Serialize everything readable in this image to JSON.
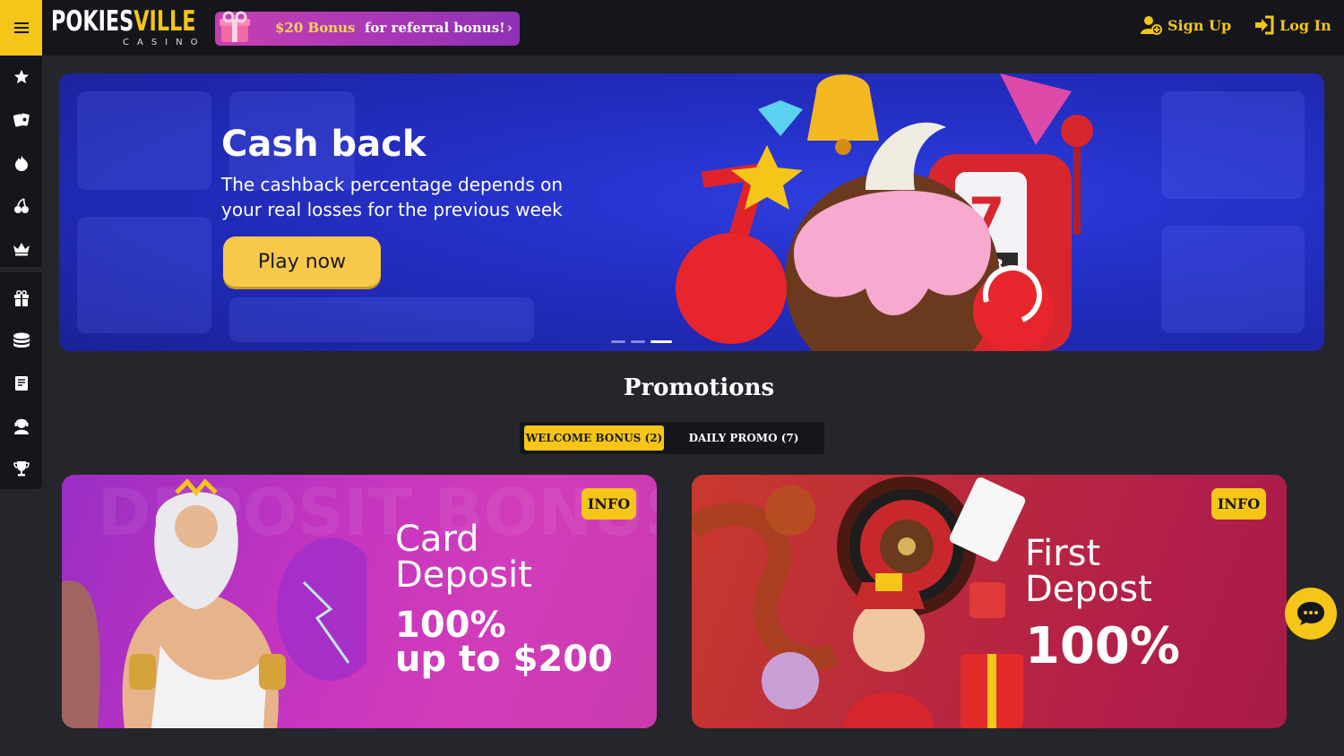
{
  "header": {
    "logo_main_a": "POKIES",
    "logo_main_b": "VILLE",
    "logo_sub": "CASINO",
    "referral_amount": "$20 Bonus",
    "referral_text": "for referral bonus!",
    "signup_label": "Sign Up",
    "login_label": "Log In"
  },
  "sidebar": {
    "icons": [
      "star-icon",
      "cards-icon",
      "fire-icon",
      "cherries-icon",
      "crown-icon",
      "gift-icon",
      "coins-icon",
      "receipt-icon",
      "support-agent-icon",
      "trophy-icon"
    ]
  },
  "banner": {
    "title": "Cash back",
    "description": "The cashback percentage depends on your real losses for the previous week",
    "button": "Play now",
    "slides": 3,
    "active_slide": 3
  },
  "promotions": {
    "title": "Promotions",
    "tabs": [
      {
        "label": "WELCOME BONUS (2)",
        "active": true
      },
      {
        "label": "DAILY PROMO (7)",
        "active": false
      }
    ],
    "cards": [
      {
        "badge": "INFO",
        "title_line1": "Card",
        "title_line2": "Deposit",
        "value_line1": "100%",
        "value_line2": "up to $200",
        "bg_text": "DEPOSIT BONUS"
      },
      {
        "badge": "INFO",
        "title_line1": "First",
        "title_line2": "Depost",
        "value_line1": "100%"
      }
    ]
  },
  "colors": {
    "accent": "#f5c518",
    "topbar": "#14161b",
    "page_bg": "#25262b",
    "banner_blue": "#2530c8",
    "card1": "#c234c0",
    "card2": "#b8283e"
  }
}
